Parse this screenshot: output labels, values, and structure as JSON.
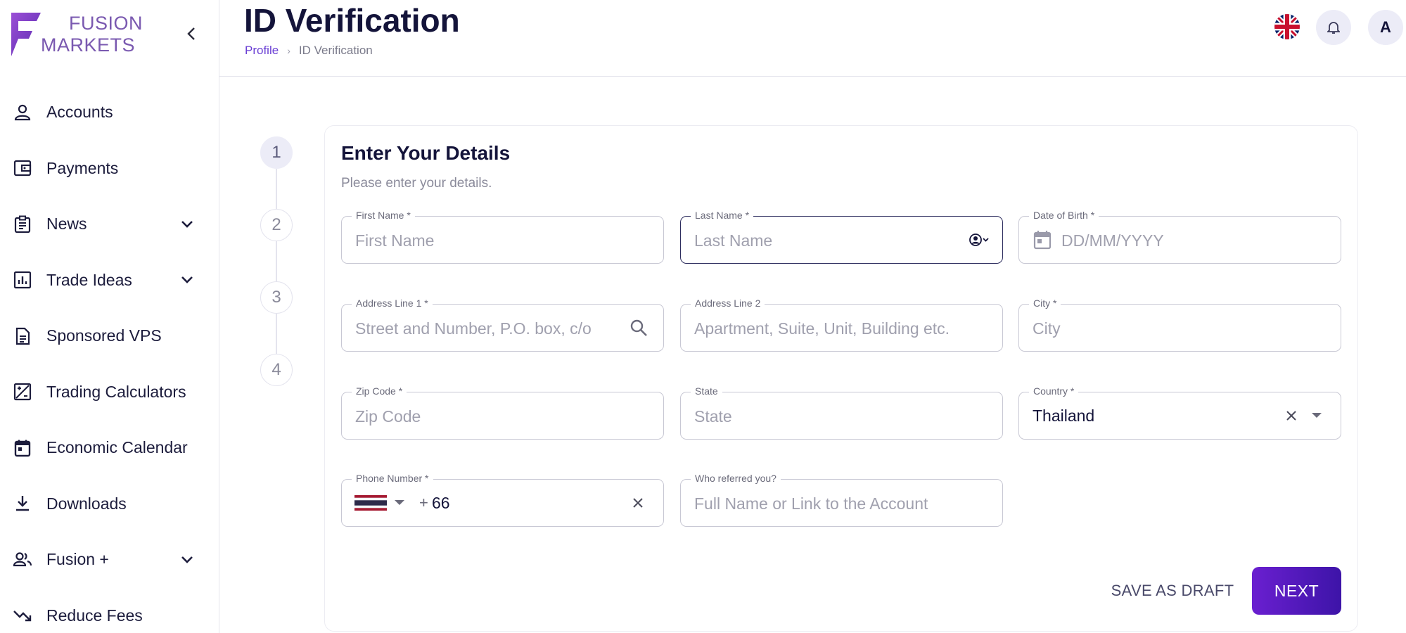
{
  "brand": {
    "line1": "FUSION",
    "line2": "MARKETS"
  },
  "sidebar": {
    "items": [
      {
        "label": "Accounts",
        "icon": "user-icon"
      },
      {
        "label": "Payments",
        "icon": "wallet-icon"
      },
      {
        "label": "News",
        "icon": "clipboard-icon",
        "expandable": true
      },
      {
        "label": "Trade Ideas",
        "icon": "bar-chart-icon",
        "expandable": true
      },
      {
        "label": "Sponsored VPS",
        "icon": "document-icon"
      },
      {
        "label": "Trading Calculators",
        "icon": "calculator-icon"
      },
      {
        "label": "Economic Calendar",
        "icon": "calendar-icon"
      },
      {
        "label": "Downloads",
        "icon": "download-icon"
      },
      {
        "label": "Fusion +",
        "icon": "group-icon",
        "expandable": true
      },
      {
        "label": "Reduce Fees",
        "icon": "trending-down-icon"
      }
    ]
  },
  "header": {
    "title": "ID Verification",
    "breadcrumb": {
      "parent": "Profile",
      "separator": "›",
      "current": "ID Verification"
    },
    "avatar_initial": "A",
    "language_flag": "uk-flag-icon"
  },
  "stepper": {
    "steps": [
      "1",
      "2",
      "3",
      "4"
    ],
    "active_step": "1"
  },
  "form": {
    "title": "Enter Your Details",
    "subtitle": "Please enter your details.",
    "fields": {
      "first_name": {
        "label": "First Name *",
        "placeholder": "First Name",
        "value": ""
      },
      "last_name": {
        "label": "Last Name *",
        "placeholder": "Last Name",
        "value": ""
      },
      "dob": {
        "label": "Date of Birth *",
        "placeholder": "DD/MM/YYYY",
        "value": ""
      },
      "address1": {
        "label": "Address Line 1 *",
        "placeholder": "Street and Number, P.O. box, c/o",
        "value": ""
      },
      "address2": {
        "label": "Address Line 2",
        "placeholder": "Apartment, Suite, Unit, Building etc.",
        "value": ""
      },
      "city": {
        "label": "City *",
        "placeholder": "City",
        "value": ""
      },
      "zip": {
        "label": "Zip Code *",
        "placeholder": "Zip Code",
        "value": ""
      },
      "state": {
        "label": "State",
        "placeholder": "State",
        "value": ""
      },
      "country": {
        "label": "Country *",
        "value": "Thailand"
      },
      "phone": {
        "label": "Phone Number *",
        "prefix": "+",
        "code": "66",
        "flag": "thailand-flag-icon"
      },
      "referral": {
        "label": "Who referred you?",
        "placeholder": "Full Name or Link to the Account",
        "value": ""
      }
    },
    "buttons": {
      "draft": "SAVE AS DRAFT",
      "next": "NEXT"
    }
  },
  "colors": {
    "accent": "#5b1ed0",
    "brand": "#7a59b0",
    "text": "#14143a"
  }
}
